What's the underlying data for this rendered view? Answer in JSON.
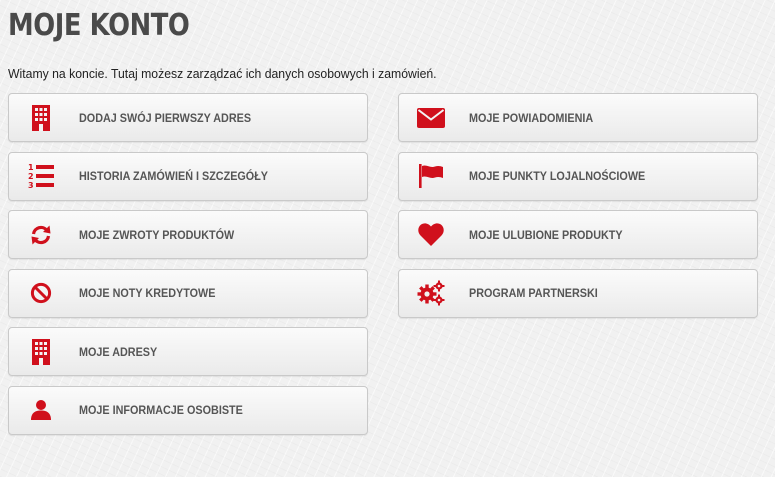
{
  "page": {
    "title": "MOJE KONTO",
    "intro": "Witamy na koncie. Tutaj możesz zarządzać ich danych osobowych i zamówień."
  },
  "colors": {
    "accent": "#d0101c",
    "label": "#555555",
    "title": "#4a4a4a"
  },
  "tiles_left": [
    {
      "label": "DODAJ SWÓJ PIERWSZY ADRES",
      "icon": "building-icon"
    },
    {
      "label": "HISTORIA ZAMÓWIEŃ I SZCZEGÓŁY",
      "icon": "ordered-list-icon"
    },
    {
      "label": "MOJE ZWROTY PRODUKTÓW",
      "icon": "refresh-icon"
    },
    {
      "label": "MOJE NOTY KREDYTOWE",
      "icon": "ban-icon"
    },
    {
      "label": "MOJE ADRESY",
      "icon": "building-icon"
    },
    {
      "label": "MOJE INFORMACJE OSOBISTE",
      "icon": "user-icon"
    }
  ],
  "tiles_right": [
    {
      "label": "MOJE POWIADOMIENIA",
      "icon": "envelope-icon"
    },
    {
      "label": "MOJE PUNKTY LOJALNOŚCIOWE",
      "icon": "flag-icon"
    },
    {
      "label": "MOJE ULUBIONE PRODUKTY",
      "icon": "heart-icon"
    },
    {
      "label": "PROGRAM PARTNERSKI",
      "icon": "gears-icon"
    }
  ]
}
